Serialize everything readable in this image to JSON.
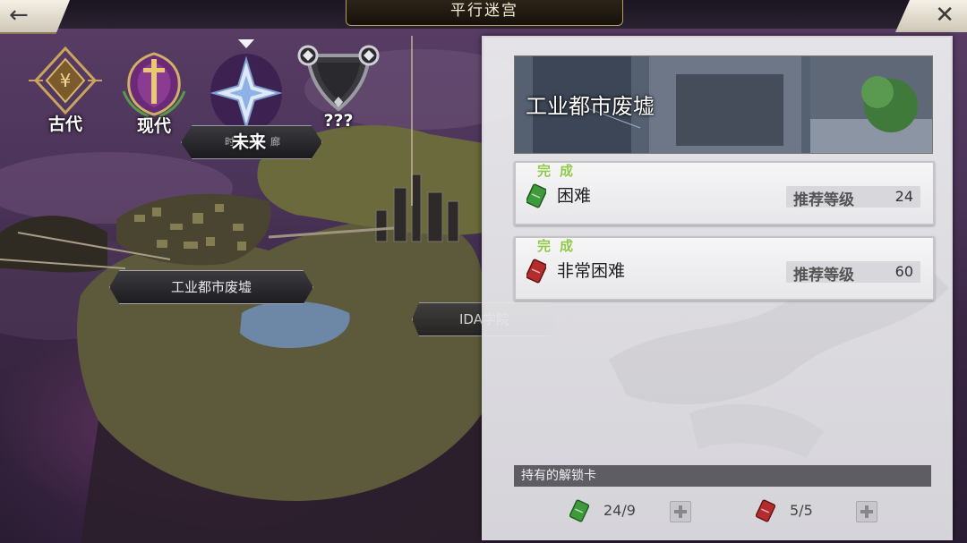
{
  "header": {
    "title": "平行迷宫",
    "back_icon": "←",
    "close_icon": "✕"
  },
  "eras": [
    {
      "label": "古代"
    },
    {
      "label": "现代"
    },
    {
      "label": "未来"
    },
    {
      "label": "???"
    }
  ],
  "future_plate": {
    "left_text": "时",
    "right_text": "廊"
  },
  "map": {
    "locations": [
      {
        "label": "工业都市废墟"
      },
      {
        "label": "IDA学院"
      }
    ]
  },
  "stage": {
    "title": "工业都市废墟",
    "difficulties": [
      {
        "status": "完成",
        "name": "困难",
        "rec_label": "推荐等级",
        "rec_level": "24",
        "card_color": "#3f9a3c"
      },
      {
        "status": "完成",
        "name": "非常困难",
        "rec_label": "推荐等级",
        "rec_level": "60",
        "card_color": "#b42c2c"
      }
    ]
  },
  "unlock_cards": {
    "title": "持有的解锁卡",
    "items": [
      {
        "count": "24/9",
        "color": "#3f9a3c"
      },
      {
        "count": "5/5",
        "color": "#b42c2c"
      }
    ]
  }
}
